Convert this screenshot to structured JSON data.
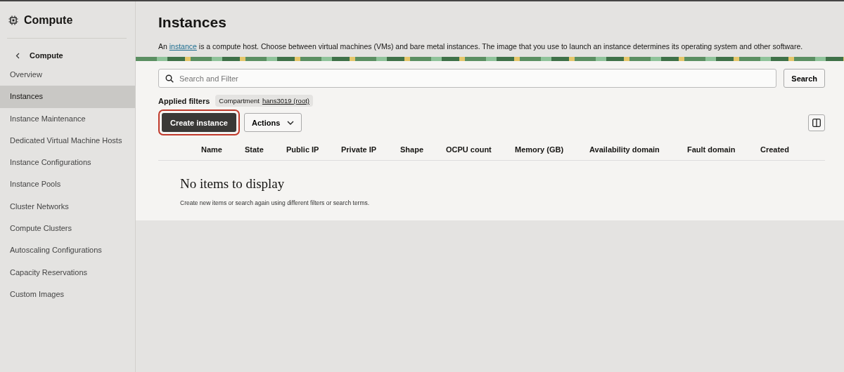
{
  "sidebar": {
    "title": "Compute",
    "back_label": "Compute",
    "items": [
      {
        "label": "Overview",
        "selected": false
      },
      {
        "label": "Instances",
        "selected": true
      },
      {
        "label": "Instance Maintenance",
        "selected": false
      },
      {
        "label": "Dedicated Virtual Machine Hosts",
        "selected": false
      },
      {
        "label": "Instance Configurations",
        "selected": false
      },
      {
        "label": "Instance Pools",
        "selected": false
      },
      {
        "label": "Cluster Networks",
        "selected": false
      },
      {
        "label": "Compute Clusters",
        "selected": false
      },
      {
        "label": "Autoscaling Configurations",
        "selected": false
      },
      {
        "label": "Capacity Reservations",
        "selected": false
      },
      {
        "label": "Custom Images",
        "selected": false
      }
    ]
  },
  "header": {
    "title": "Instances",
    "description_before": "An",
    "description_link": "instance",
    "description_after": "is a compute host. Choose between virtual machines (VMs) and bare metal instances. The image that you use to launch an instance determines its operating system and other software."
  },
  "search": {
    "placeholder": "Search and Filter",
    "button": "Search"
  },
  "applied_filters": {
    "label": "Applied filters",
    "chip_label": "Compartment",
    "chip_value": "hans3019 (root)"
  },
  "toolbar": {
    "create_button": "Create instance",
    "create_highlighted": true,
    "actions_button": "Actions"
  },
  "table": {
    "columns": [
      "Name",
      "State",
      "Public IP",
      "Private IP",
      "Shape",
      "OCPU count",
      "Memory (GB)",
      "Availability domain",
      "Fault domain",
      "Created"
    ],
    "empty_title": "No items to display",
    "empty_hint": "Create new items or search again using different filters or search terms."
  }
}
